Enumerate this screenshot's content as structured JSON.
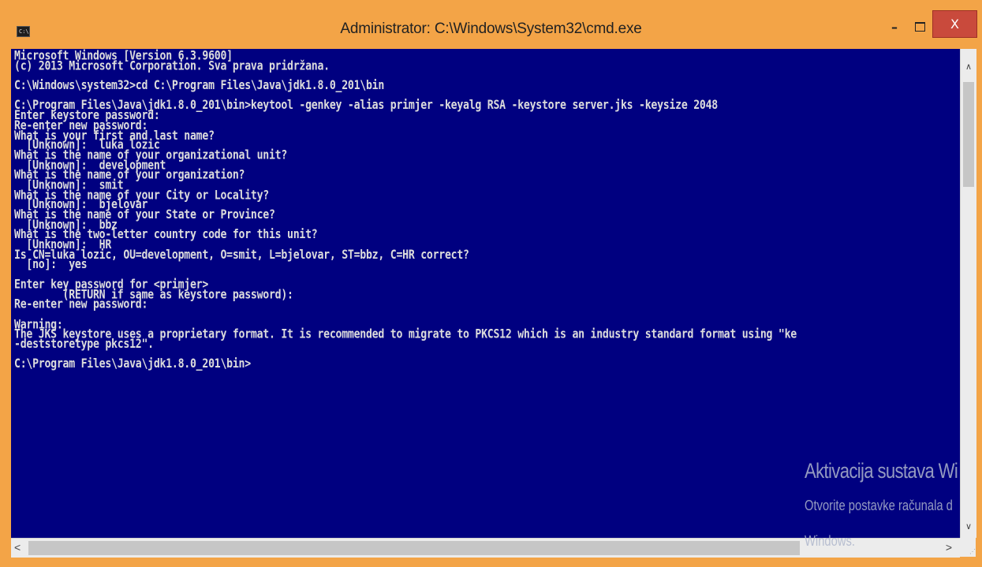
{
  "window": {
    "title": "Administrator: C:\\Windows\\System32\\cmd.exe",
    "icon": "cmd-icon",
    "icon_text": "C:\\",
    "controls": {
      "minimize": "–",
      "close": "X"
    }
  },
  "colors": {
    "titlebar": "#f3a447",
    "console_background": "#000080",
    "console_text": "#dcdcdc",
    "close_button": "#c94a3c"
  },
  "console": {
    "lines": [
      "Microsoft Windows [Version 6.3.9600]",
      "(c) 2013 Microsoft Corporation. Sva prava pridržana.",
      "",
      "C:\\Windows\\system32>cd C:\\Program Files\\Java\\jdk1.8.0_201\\bin",
      "",
      "C:\\Program Files\\Java\\jdk1.8.0_201\\bin>keytool -genkey -alias primjer -keyalg RSA -keystore server.jks -keysize 2048",
      "Enter keystore password:",
      "Re-enter new password:",
      "What is your first and last name?",
      "  [Unknown]:  luka lozic",
      "What is the name of your organizational unit?",
      "  [Unknown]:  development",
      "What is the name of your organization?",
      "  [Unknown]:  smit",
      "What is the name of your City or Locality?",
      "  [Unknown]:  bjelovar",
      "What is the name of your State or Province?",
      "  [Unknown]:  bbz",
      "What is the two-letter country code for this unit?",
      "  [Unknown]:  HR",
      "Is CN=luka lozic, OU=development, O=smit, L=bjelovar, ST=bbz, C=HR correct?",
      "  [no]:  yes",
      "",
      "Enter key password for <primjer>",
      "        (RETURN if same as keystore password):",
      "Re-enter new password:",
      "",
      "Warning:",
      "The JKS keystore uses a proprietary format. It is recommended to migrate to PKCS12 which is an industry standard format using \"ke",
      "-deststoretype pkcs12\".",
      "",
      "C:\\Program Files\\Java\\jdk1.8.0_201\\bin>"
    ]
  },
  "watermark": {
    "title": "Aktivacija sustava Wi",
    "subtitle": "Otvorite postavke računala d",
    "subtitle2": "Windows."
  },
  "scrollbars": {
    "up_arrow": "∧",
    "down_arrow": "∨",
    "left_arrow": "<",
    "right_arrow": ">"
  }
}
